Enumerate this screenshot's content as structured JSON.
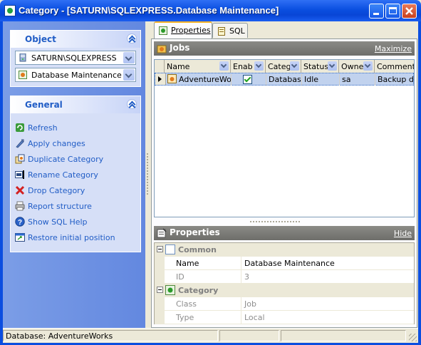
{
  "window": {
    "title": "Category - [SATURN\\SQLEXPRESS.Database Maintenance]"
  },
  "left_panel": {
    "object_group": {
      "title": "Object",
      "server": "SATURN\\SQLEXPRESS",
      "category": "Database Maintenance"
    },
    "general_group": {
      "title": "General",
      "actions": [
        {
          "label": "Refresh",
          "icon": "refresh-icon"
        },
        {
          "label": "Apply changes",
          "icon": "apply-icon"
        },
        {
          "label": "Duplicate Category",
          "icon": "duplicate-icon"
        },
        {
          "label": "Rename Category",
          "icon": "rename-icon"
        },
        {
          "label": "Drop Category",
          "icon": "drop-icon"
        },
        {
          "label": "Report structure",
          "icon": "report-icon"
        },
        {
          "label": "Show SQL Help",
          "icon": "help-icon"
        },
        {
          "label": "Restore initial position",
          "icon": "restore-icon"
        }
      ]
    }
  },
  "tabs": [
    {
      "label": "Properties",
      "active": true
    },
    {
      "label": "SQL",
      "active": false
    }
  ],
  "jobs_panel": {
    "title": "Jobs",
    "action": "Maximize",
    "columns": [
      "Name",
      "Enab",
      "Categ",
      "Status",
      "Owne",
      "Comment"
    ],
    "rows": [
      {
        "name": "AdventureWor",
        "enabled": true,
        "category": "Database",
        "status": "Idle",
        "owner": "sa",
        "comment": "Backup d"
      }
    ]
  },
  "properties_panel": {
    "title": "Properties",
    "action": "Hide",
    "sections": [
      {
        "title": "Common",
        "rows": [
          {
            "name": "Name",
            "value": "Database Maintenance",
            "readonly": false
          },
          {
            "name": "ID",
            "value": "3",
            "readonly": true
          }
        ]
      },
      {
        "title": "Category",
        "rows": [
          {
            "name": "Class",
            "value": "Job",
            "readonly": true
          },
          {
            "name": "Type",
            "value": "Local",
            "readonly": true
          }
        ]
      }
    ]
  },
  "statusbar": {
    "database": "Database: AdventureWorks"
  },
  "colors": {
    "titlebar": "#0a4fe0",
    "link": "#215dc6",
    "selection": "#c1d2ee"
  }
}
